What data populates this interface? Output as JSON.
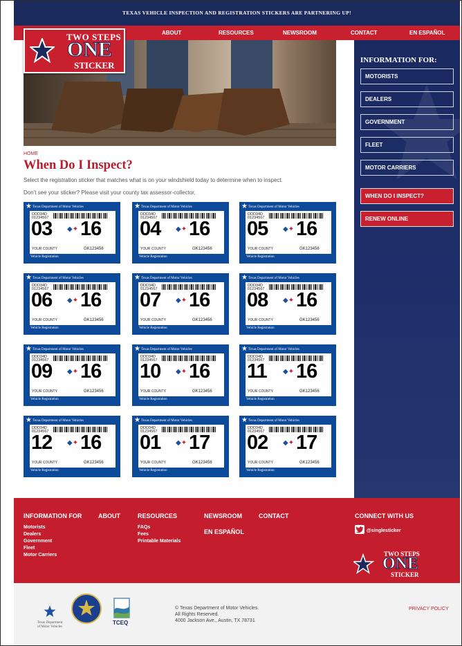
{
  "banner": {
    "text": "TEXAS VEHICLE INSPECTION AND REGISTRATION STICKERS ARE PARTNERING UP!"
  },
  "logo": {
    "line1": "TWO STEPS",
    "line2": "ONE",
    "line3": "STICKER"
  },
  "nav": {
    "items": [
      "ABOUT",
      "RESOURCES",
      "NEWSROOM",
      "CONTACT",
      "EN ESPAÑOL"
    ]
  },
  "hero": {
    "image": "boots-photo"
  },
  "main": {
    "breadcrumb": "HOME",
    "title": "When Do I Inspect?",
    "intro1": "Select the registration sticker that matches what is on your windshield today to determine when to inspect.",
    "intro2": "Don't see your sticker? Please visit your county tax assessor-collector."
  },
  "sticker_template": {
    "header": "Texas Department of Motor Vehicles",
    "code1": "DDD34D",
    "code2": "01234567",
    "county": "YOUR COUNTY",
    "serial": "GK123456",
    "footer": "Vehicle Registration"
  },
  "stickers": [
    {
      "month": "03",
      "year": "16"
    },
    {
      "month": "04",
      "year": "16"
    },
    {
      "month": "05",
      "year": "16"
    },
    {
      "month": "06",
      "year": "16"
    },
    {
      "month": "07",
      "year": "16"
    },
    {
      "month": "08",
      "year": "16"
    },
    {
      "month": "09",
      "year": "16"
    },
    {
      "month": "10",
      "year": "16"
    },
    {
      "month": "11",
      "year": "16"
    },
    {
      "month": "12",
      "year": "16"
    },
    {
      "month": "01",
      "year": "17"
    },
    {
      "month": "02",
      "year": "17"
    }
  ],
  "sidebar": {
    "heading": "INFORMATION FOR:",
    "items": [
      "MOTORISTS",
      "DEALERS",
      "GOVERNMENT",
      "FLEET",
      "MOTOR CARRIERS"
    ],
    "actions": [
      "WHEN DO I INSPECT?",
      "RENEW ONLINE"
    ]
  },
  "footer": {
    "info_head": "INFORMATION FOR",
    "info_links": [
      "Motorists",
      "Dealers",
      "Government",
      "Fleet",
      "Motor Carriers"
    ],
    "about": "ABOUT",
    "resources_head": "RESOURCES",
    "resources_links": [
      "FAQs",
      "Fees",
      "Printable Materials"
    ],
    "newsroom": "NEWSROOM",
    "espanol": "EN ESPAÑOL",
    "contact": "CONTACT",
    "connect": "CONNECT WITH US",
    "twitter": "@singlesticker"
  },
  "bottom": {
    "txdmv_line1": "Texas Department",
    "txdmv_line2": "of Motor Vehicles",
    "tceq": "TCEQ",
    "copyright1": "© Texas Department of Motor Vehicles.",
    "copyright2": "All Rights Reserved.",
    "copyright3": "4000 Jackson Ave., Austin, TX 78731",
    "privacy": "PRIVACY POLICY"
  },
  "colors": {
    "red": "#c8202f",
    "navy": "#1b2a5c",
    "sticker_blue": "#0e4a9a"
  }
}
